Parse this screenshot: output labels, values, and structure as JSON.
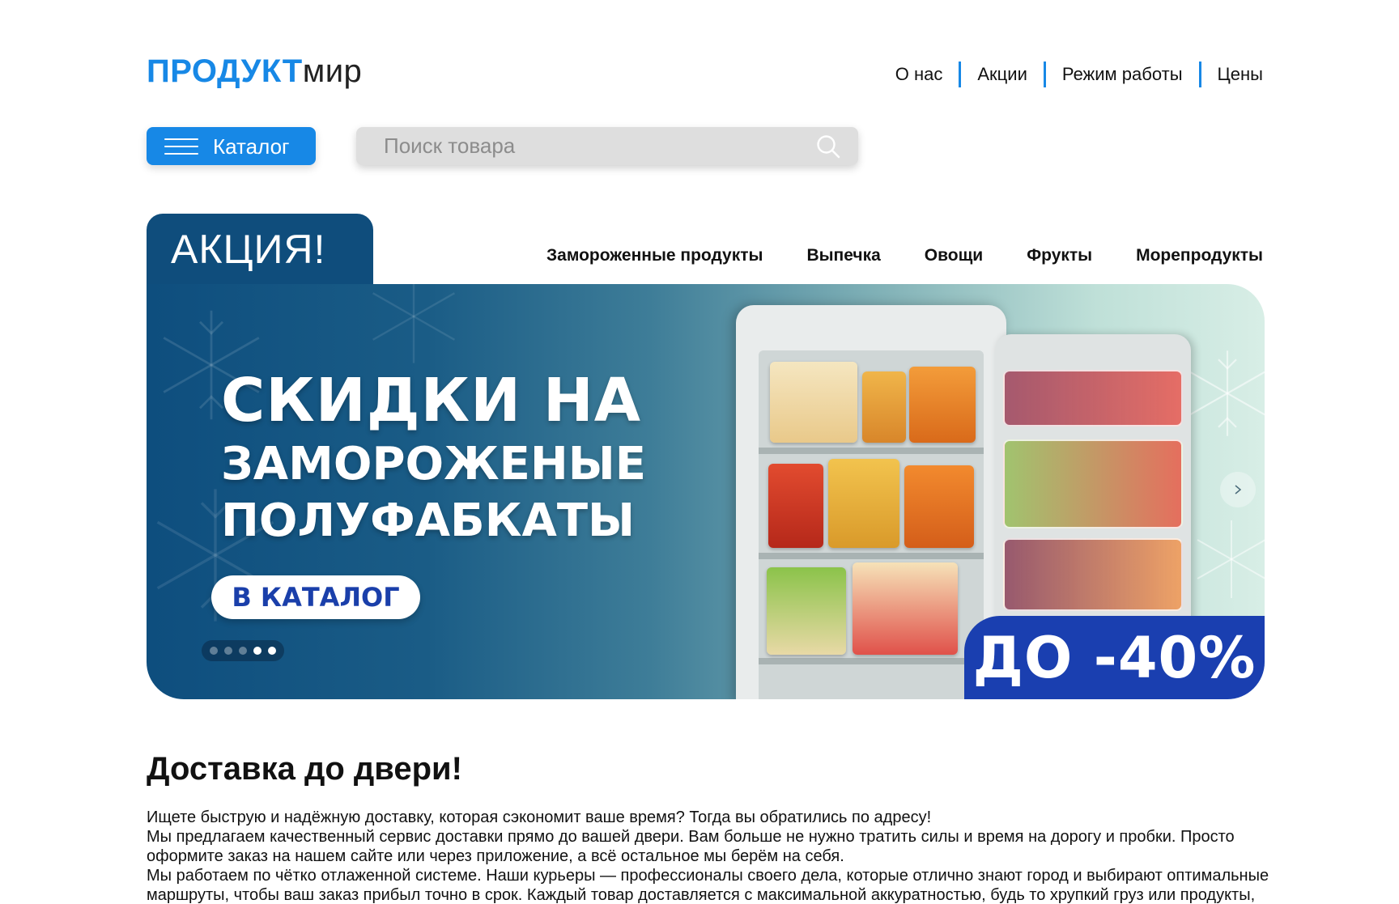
{
  "logo": {
    "brand": "ПРОДУКТ",
    "suffix": "мир"
  },
  "topnav": [
    {
      "label": "О нас"
    },
    {
      "label": "Акции"
    },
    {
      "label": "Режим работы"
    },
    {
      "label": "Цены"
    }
  ],
  "catalog_button": {
    "label": "Каталог",
    "icon": "hamburger-menu-icon"
  },
  "search": {
    "placeholder": "Поиск товара",
    "icon": "search-icon"
  },
  "promo_tab": {
    "label": "АКЦИЯ!"
  },
  "categories": [
    {
      "label": "Замороженные продукты"
    },
    {
      "label": "Выпечка"
    },
    {
      "label": "Овощи"
    },
    {
      "label": "Фрукты"
    },
    {
      "label": "Морепродукты"
    }
  ],
  "banner": {
    "line1": "СКИДКИ НА",
    "line2": "ЗАМОРОЖЕНЫЕ",
    "line3": "ПОЛУФАБКАТЫ",
    "button": "В КАТАЛОГ",
    "discount": "ДО -40%",
    "slides_total": 5,
    "active_slides": [
      4,
      5
    ],
    "next_icon": "chevron-right-icon"
  },
  "delivery": {
    "title": "Доставка до двери!",
    "p1": "Ищете быструю и надёжную доставку, которая сэкономит ваше время? Тогда вы обратились по адресу!",
    "p2": "Мы предлагаем качественный сервис доставки прямо до вашей двери. Вам больше не нужно тратить силы и время на дорогу и пробки. Просто оформите заказ на нашем сайте или через приложение, а всё остальное мы берём на себя.",
    "p3": "Мы работаем по чётко отлаженной системе. Наши курьеры — профессионалы своего дела, которые отлично знают город и выбирают оптимальные маршруты, чтобы ваш заказ прибыл точно в срок. Каждый товар доставляется с максимальной аккуратностью, будь то хрупкий груз или продукты, требующие особого температурного режима."
  },
  "colors": {
    "accent": "#1788e6",
    "banner_dark": "#0f4d7c",
    "discount": "#1a3fb0"
  }
}
